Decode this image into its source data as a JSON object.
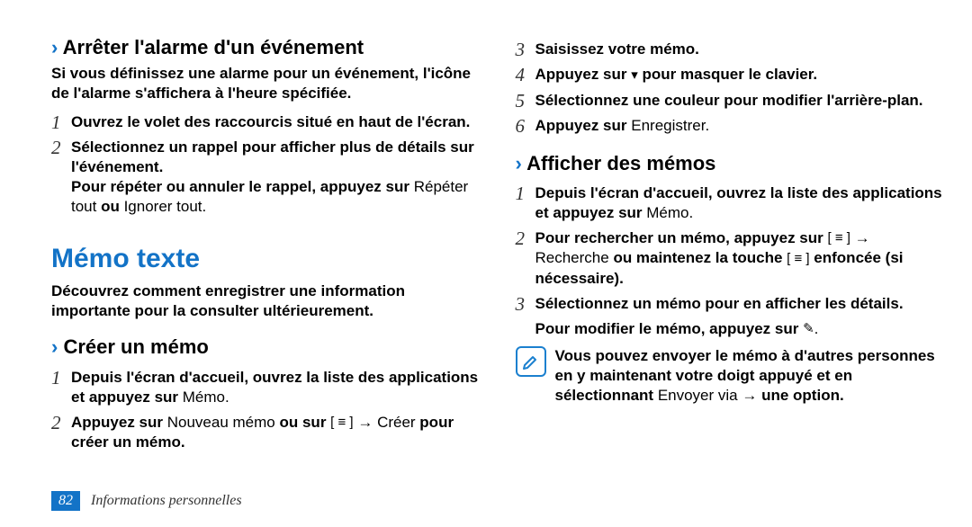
{
  "left": {
    "h3_prefix": "›",
    "h3_title": "Arrêter l'alarme d'un événement",
    "intro": "Si vous définissez une alarme pour un événement, l'icône de l'alarme s'affichera à l'heure spécifiée.",
    "steps": [
      {
        "n": "1",
        "text_bold": "Ouvrez le volet des raccourcis situé en haut de l'écran.",
        "text_plain": ""
      },
      {
        "n": "2",
        "text_bold": "Sélectionnez un rappel pour afficher plus de détails sur l'événement.",
        "after_bold": "Pour répéter ou annuler le rappel, appuyez sur ",
        "after_plain1": "Répéter tout",
        "after_bold2": " ou ",
        "after_plain2": "Ignorer tout",
        "after_plain3": "."
      }
    ],
    "memo_h2": "Mémo texte",
    "memo_intro": "Découvrez comment enregistrer une information importante pour la consulter ultérieurement.",
    "h3b_title": "Créer un mémo",
    "memo_steps": [
      {
        "n": "1",
        "bold1": "Depuis l'écran d'accueil, ouvrez la liste des applications et appuyez sur ",
        "plain1": "Mémo",
        "plain2": "."
      },
      {
        "n": "2",
        "bold1": "Appuyez sur ",
        "plain1": "Nouveau mémo",
        "bold2": " ou sur ",
        "icon": "[ ≡ ]",
        "arrow": " → ",
        "plain2": "Créer",
        "bold3": " pour créer un mémo."
      }
    ]
  },
  "right": {
    "steps_cont": [
      {
        "n": "3",
        "bold": "Saisissez votre mémo."
      },
      {
        "n": "4",
        "bold": "Appuyez sur ",
        "icon": "▾",
        "bold2": " pour masquer le clavier."
      },
      {
        "n": "5",
        "bold": "Sélectionnez une couleur pour modifier l'arrière-plan."
      },
      {
        "n": "6",
        "bold": "Appuyez sur ",
        "plain": "Enregistrer",
        "end": "."
      }
    ],
    "h3_prefix": "›",
    "h3_title": "Afficher des mémos",
    "af_steps": [
      {
        "n": "1",
        "bold1": "Depuis l'écran d'accueil, ouvrez la liste des applications et appuyez sur ",
        "plain": "Mémo",
        "end": "."
      },
      {
        "n": "2",
        "bold1": "Pour rechercher un mémo, appuyez sur ",
        "icon": "[ ≡ ]",
        "arrow": " → ",
        "plain1": "Recherche",
        "bold2": " ou maintenez la touche ",
        "icon2": "[ ≡ ]",
        "bold3": " enfoncée (si nécessaire)."
      },
      {
        "n": "3",
        "bold": "Sélectionnez un mémo pour en afficher les détails."
      },
      {
        "n": "",
        "bold1": "Pour modifier le mémo, appuyez sur ",
        "icon": "✎",
        "end": "."
      }
    ],
    "note": {
      "bold1": "Vous pouvez envoyer le mémo à d'autres personnes en y maintenant votre doigt appuyé et en sélectionnant ",
      "plain1": "Envoyer via",
      "arrow": " → ",
      "bold2": "une option."
    }
  },
  "footer": {
    "page": "82",
    "label": "Informations personnelles"
  }
}
